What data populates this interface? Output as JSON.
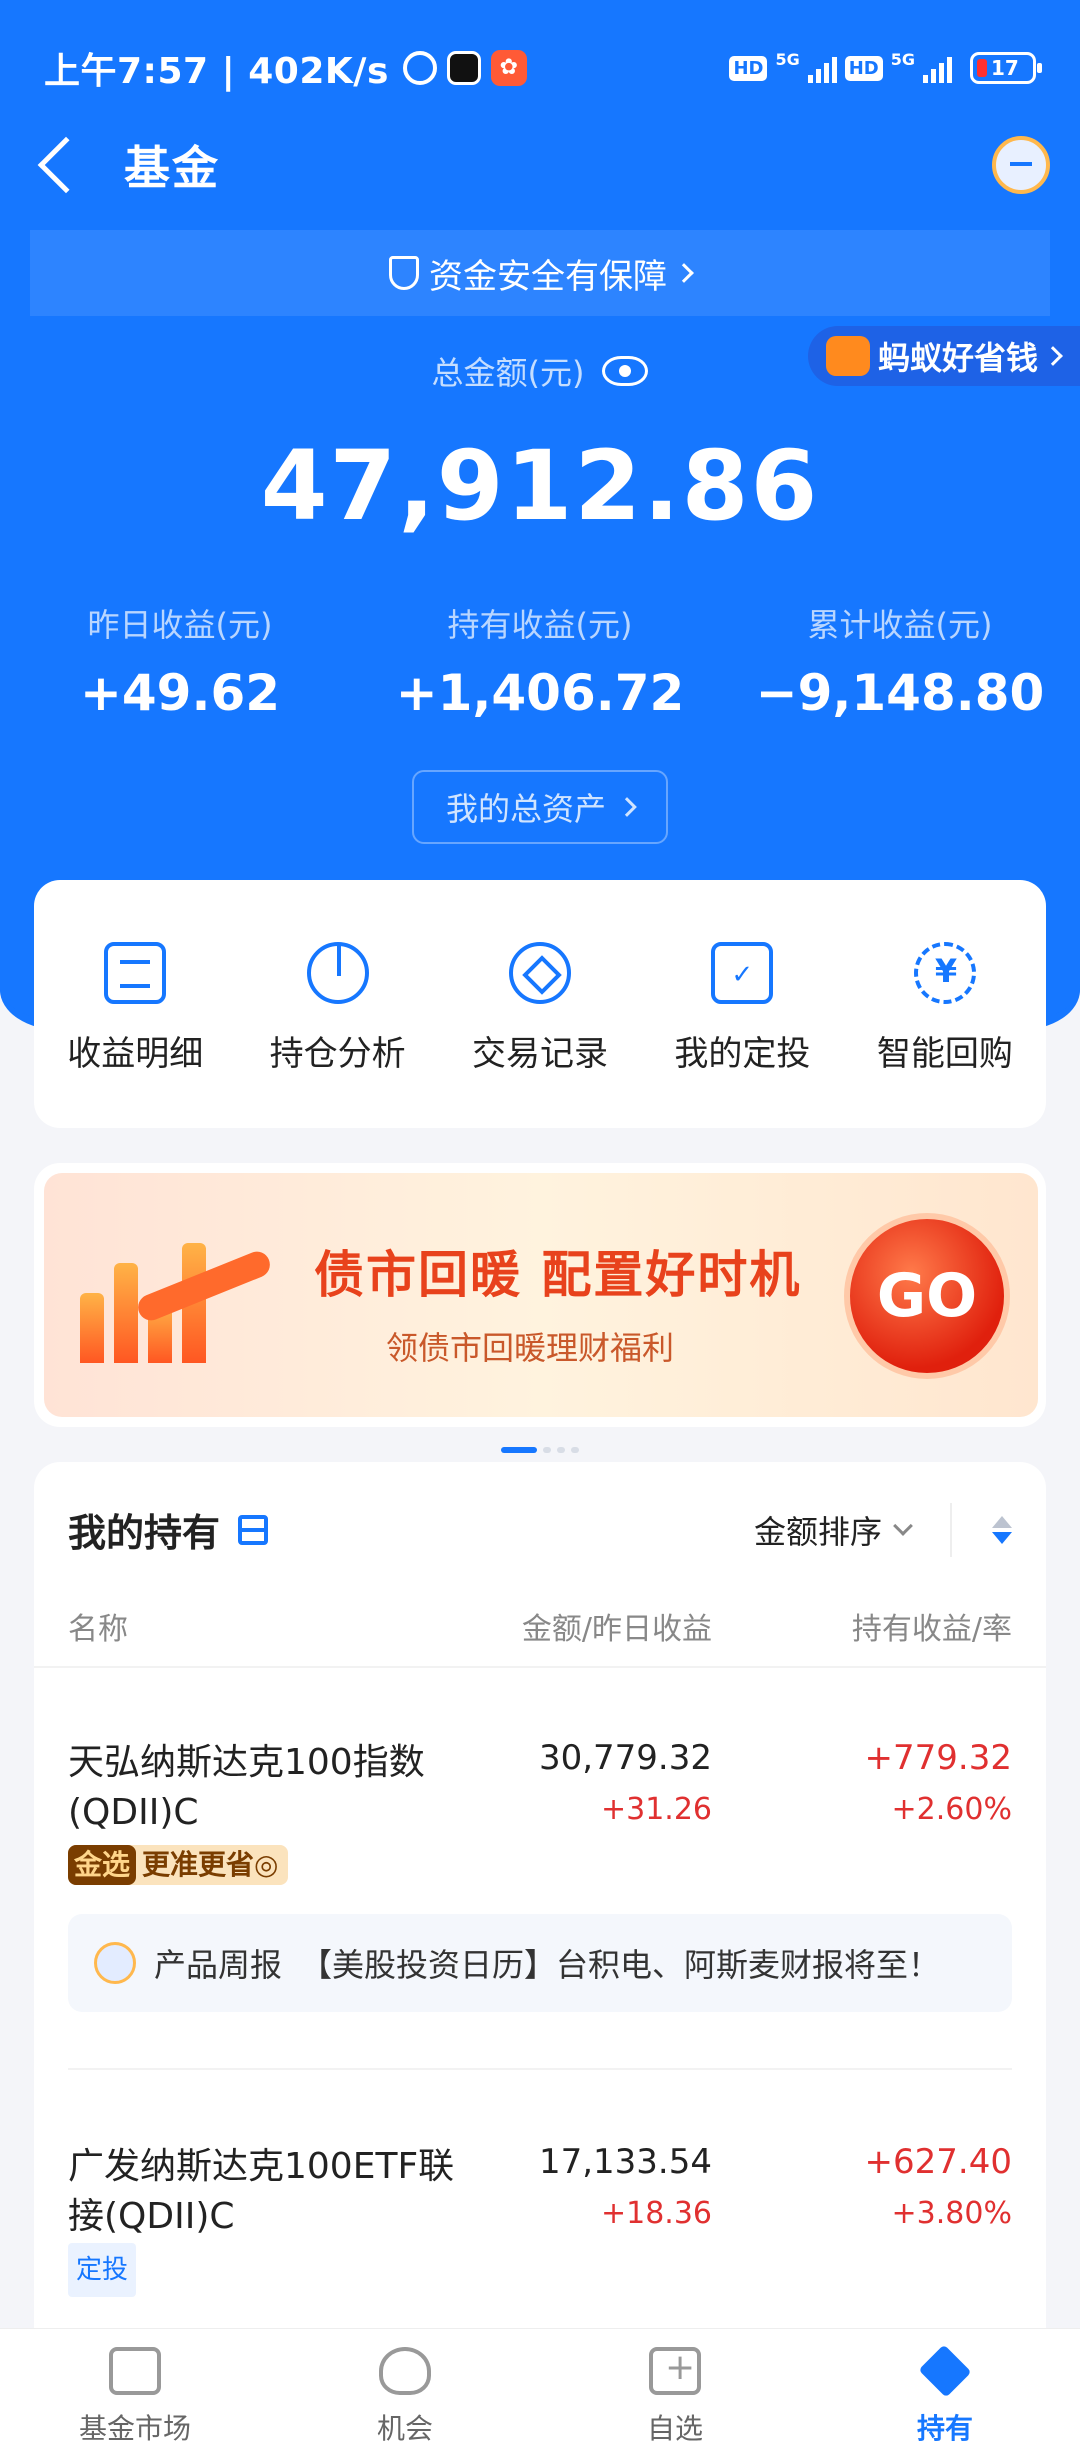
{
  "status": {
    "time": "上午7:57 | 402K/s",
    "hd1": "HD",
    "net1": "5G",
    "hd2": "HD",
    "net2": "5G",
    "battery": "17"
  },
  "header": {
    "title": "基金"
  },
  "safety": {
    "label": "资金安全有保障"
  },
  "promo_chip": {
    "label": "蚂蚁好省钱"
  },
  "summary": {
    "total_label": "总金额(元)",
    "total_value": "47,912.86",
    "stats": [
      {
        "label": "昨日收益(元)",
        "value": "+49.62"
      },
      {
        "label": "持有收益(元)",
        "value": "+1,406.72"
      },
      {
        "label": "累计收益(元)",
        "value": "−9,148.80"
      }
    ],
    "assets_button": "我的总资产"
  },
  "quick_actions": [
    {
      "label": "收益明细",
      "icon": "document-icon"
    },
    {
      "label": "持仓分析",
      "icon": "pie-chart-icon"
    },
    {
      "label": "交易记录",
      "icon": "diamond-circle-icon"
    },
    {
      "label": "我的定投",
      "icon": "calendar-check-icon"
    },
    {
      "label": "智能回购",
      "icon": "yen-cycle-icon"
    }
  ],
  "banner": {
    "title": "债市回暖 配置好时机",
    "subtitle": "领债市回暖理财福利",
    "cta": "GO",
    "page_index": 1,
    "page_count": 4
  },
  "holdings": {
    "title": "我的持有",
    "sort_label": "金额排序",
    "columns": {
      "name": "名称",
      "amount": "金额/昨日收益",
      "gain": "持有收益/率"
    },
    "funds": [
      {
        "name": "天弘纳斯达克100指数(QDII)C",
        "amount": "30,779.32",
        "yesterday": "+31.26",
        "gain": "+779.32",
        "rate": "+2.60%",
        "tag_key": "金选",
        "tag_text": "更准更省"
      },
      {
        "name": "广发纳斯达克100ETF联接(QDII)C",
        "amount": "17,133.54",
        "yesterday": "+18.36",
        "gain": "+627.40",
        "rate": "+3.80%",
        "tag": "定投"
      }
    ],
    "report": {
      "prefix": "产品周报",
      "text": "【美股投资日历】台积电、阿斯麦财报将至！"
    }
  },
  "bottom_nav": [
    {
      "label": "基金市场",
      "icon": "market-icon",
      "active": false
    },
    {
      "label": "机会",
      "icon": "binoculars-icon",
      "active": false
    },
    {
      "label": "自选",
      "icon": "add-favorite-icon",
      "active": false
    },
    {
      "label": "持有",
      "icon": "layers-icon",
      "active": true
    }
  ],
  "colors": {
    "primary": "#1677ff",
    "gain_red": "#e03030",
    "background": "#f4f5f9"
  }
}
